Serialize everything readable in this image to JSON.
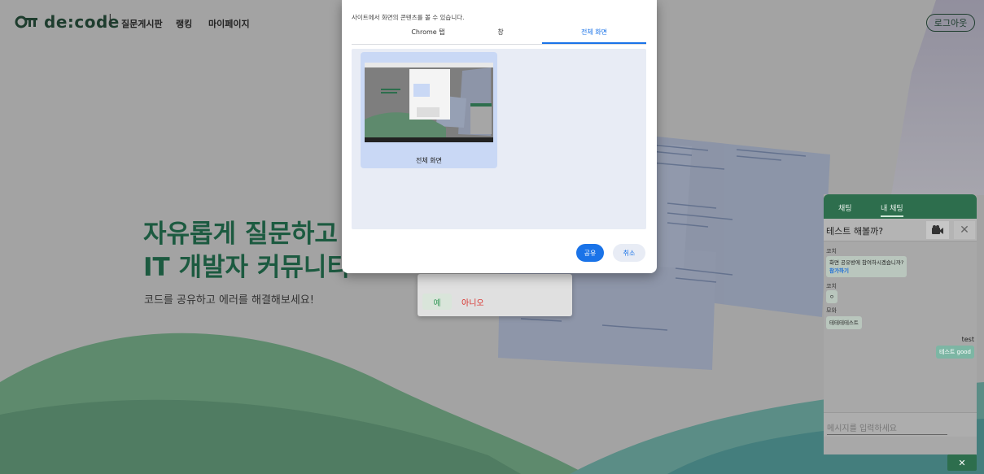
{
  "nav": {
    "logo_text": "de:code",
    "separator": "|",
    "links": [
      "질문게시판",
      "랭킹",
      "마이페이지"
    ],
    "logout_label": "로그아웃"
  },
  "hero": {
    "title_line1": "자유롭게 질문하고 딥",
    "title_line2": "IT 개발자 커뮤니티",
    "subtitle": "코드를 공유하고 에러를 해결해보세요!"
  },
  "confirm_dialog": {
    "yes_label": "예",
    "no_label": "아니오"
  },
  "share_picker": {
    "description": "사이트에서 화면의 콘텐츠를 볼 수 있습니다.",
    "tabs": [
      {
        "label": "Chrome 탭",
        "active": false
      },
      {
        "label": "창",
        "active": false
      },
      {
        "label": "전체 화면",
        "active": true
      }
    ],
    "screen_option_label": "전체 화면",
    "share_label": "공유",
    "cancel_label": "취소"
  },
  "chat": {
    "tabs": [
      "채팅",
      "내 채팅"
    ],
    "room_title": "테스트 해볼까?",
    "camera_icon": "video-camera-icon",
    "close_symbol": "✕",
    "messages": [
      {
        "sender": "코치",
        "text": "화면 공유방에 참여하시겠습니까?",
        "link": "참가하기"
      },
      {
        "sender": "코치",
        "text": "ㅇ"
      },
      {
        "sender": "모와",
        "text": "테테테테스트"
      }
    ],
    "my_message": {
      "sender": "test",
      "text": "테스트 good"
    },
    "input_placeholder": "메시지를 입력하세요",
    "minimize_symbol": "✕"
  },
  "colors": {
    "brand_green": "#2d6e4d",
    "hero_green": "#1c5a40",
    "chrome_blue": "#1a73e8",
    "no_red": "#d9302c"
  }
}
